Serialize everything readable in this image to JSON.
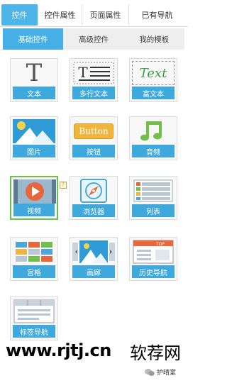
{
  "top_tabs": [
    "控件",
    "控件属性",
    "页面属性",
    "已有导航"
  ],
  "sub_tabs": [
    "基础控件",
    "高级控件",
    "我的模板"
  ],
  "tiles": [
    "文本",
    "多行文本",
    "富文本",
    "图片",
    "按钮",
    "音频",
    "视频",
    "浏览器",
    "列表",
    "宫格",
    "画廊",
    "历史导航",
    "标签导航"
  ],
  "tile_art": {
    "text_glyph": "T",
    "richtext_label": "Text",
    "button_label": "Button",
    "top_label": "TOP",
    "help_mark": "?"
  },
  "watermark": {
    "url": "www.rjtj.cn",
    "site": "软荐网"
  },
  "wechat": {
    "name": "护晴室"
  },
  "colors": {
    "accent": "#46b0e6",
    "tile_label_bg": "#3fa8dd",
    "selected_border": "#6fbf4a"
  }
}
